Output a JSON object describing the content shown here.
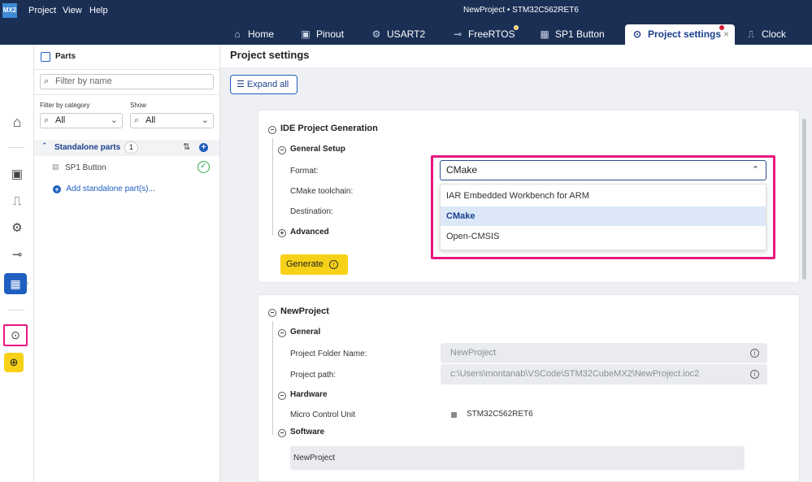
{
  "app": {
    "logo": "MX2",
    "menu": [
      "Project",
      "View",
      "Help"
    ],
    "window_title": "NewProject  •  STM32C562RET6"
  },
  "tabs": [
    {
      "label": "Home",
      "icon": "⌂"
    },
    {
      "label": "Pinout",
      "icon": "▣"
    },
    {
      "label": "USART2",
      "icon": "⚙"
    },
    {
      "label": "FreeRTOS",
      "icon": "⊸"
    },
    {
      "label": "SP1 Button",
      "icon": "▦"
    },
    {
      "label": "Project settings",
      "icon": "⊙",
      "close": "×"
    },
    {
      "label": "Clock",
      "icon": "⎍"
    }
  ],
  "parts": {
    "title": "Parts",
    "filter_placeholder": "Filter by name",
    "filter_category_label": "Filter by category",
    "show_label": "Show",
    "category_value": "All",
    "show_value": "All",
    "group_label": "Standalone parts",
    "group_count": "1",
    "item_label": "SP1 Button",
    "add_label": "Add standalone part(s)..."
  },
  "main": {
    "title": "Project settings",
    "expand_label": "Expand all",
    "ide": {
      "title": "IDE Project Generation",
      "general_setup": "General Setup",
      "format_label": "Format:",
      "format_value": "CMake",
      "toolchain_label": "CMake toolchain:",
      "destination_label": "Destination:",
      "advanced": "Advanced",
      "generate_label": "Generate",
      "dropdown_options": [
        "IAR Embedded Workbench for ARM",
        "CMake",
        "Open-CMSIS"
      ],
      "selected_option": "CMake"
    },
    "project": {
      "title": "NewProject",
      "general": "General",
      "folder_label": "Project Folder Name:",
      "folder_value": "NewProject",
      "path_label": "Project path:",
      "path_value": "c:\\Users\\montanab\\VSCode\\STM32CubeMX2\\NewProject.ioc2",
      "hardware": "Hardware",
      "mcu_label": "Micro Control Unit",
      "mcu_value": "STM32C562RET6",
      "software": "Software",
      "software_value": "NewProject"
    }
  },
  "colors": {
    "topbar": "#1b2f55",
    "accent": "#1b3f8c",
    "highlight": "#e8177f",
    "generate": "#f7d117",
    "check": "#2eaa4a"
  }
}
